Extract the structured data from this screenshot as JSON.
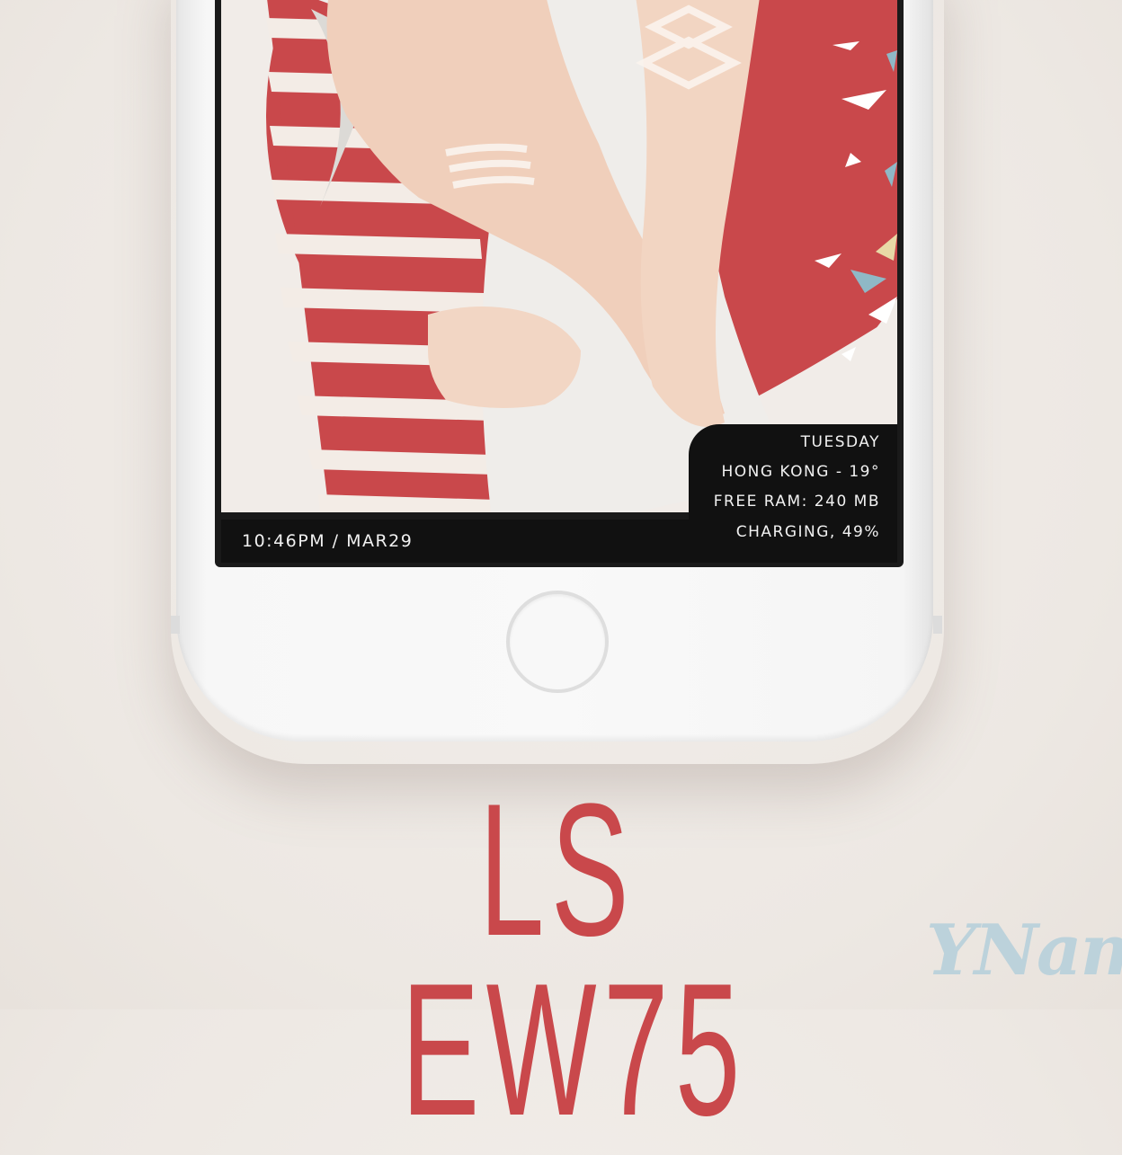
{
  "lockscreen": {
    "day": "TUESDAY",
    "weather": "HONG KONG - 19°",
    "ram": "FREE RAM: 240 MB",
    "battery": "CHARGING, 49%",
    "time_date": "10:46PM / MAR29"
  },
  "title": "LS EW75",
  "logo": "YNam",
  "colors": {
    "accent": "#c9484b",
    "background": "#efeae5",
    "widget_bg": "#111111",
    "logo": "#bcd2db"
  }
}
